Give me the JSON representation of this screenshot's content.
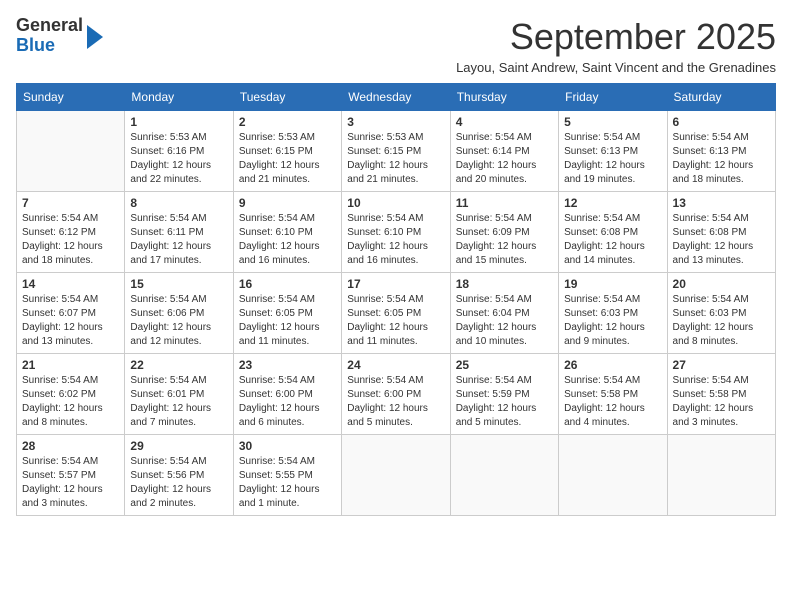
{
  "header": {
    "logo_line1": "General",
    "logo_line2": "Blue",
    "month": "September 2025",
    "subtitle": "Layou, Saint Andrew, Saint Vincent and the Grenadines"
  },
  "weekdays": [
    "Sunday",
    "Monday",
    "Tuesday",
    "Wednesday",
    "Thursday",
    "Friday",
    "Saturday"
  ],
  "weeks": [
    [
      {
        "day": "",
        "info": ""
      },
      {
        "day": "1",
        "info": "Sunrise: 5:53 AM\nSunset: 6:16 PM\nDaylight: 12 hours\nand 22 minutes."
      },
      {
        "day": "2",
        "info": "Sunrise: 5:53 AM\nSunset: 6:15 PM\nDaylight: 12 hours\nand 21 minutes."
      },
      {
        "day": "3",
        "info": "Sunrise: 5:53 AM\nSunset: 6:15 PM\nDaylight: 12 hours\nand 21 minutes."
      },
      {
        "day": "4",
        "info": "Sunrise: 5:54 AM\nSunset: 6:14 PM\nDaylight: 12 hours\nand 20 minutes."
      },
      {
        "day": "5",
        "info": "Sunrise: 5:54 AM\nSunset: 6:13 PM\nDaylight: 12 hours\nand 19 minutes."
      },
      {
        "day": "6",
        "info": "Sunrise: 5:54 AM\nSunset: 6:13 PM\nDaylight: 12 hours\nand 18 minutes."
      }
    ],
    [
      {
        "day": "7",
        "info": "Sunrise: 5:54 AM\nSunset: 6:12 PM\nDaylight: 12 hours\nand 18 minutes."
      },
      {
        "day": "8",
        "info": "Sunrise: 5:54 AM\nSunset: 6:11 PM\nDaylight: 12 hours\nand 17 minutes."
      },
      {
        "day": "9",
        "info": "Sunrise: 5:54 AM\nSunset: 6:10 PM\nDaylight: 12 hours\nand 16 minutes."
      },
      {
        "day": "10",
        "info": "Sunrise: 5:54 AM\nSunset: 6:10 PM\nDaylight: 12 hours\nand 16 minutes."
      },
      {
        "day": "11",
        "info": "Sunrise: 5:54 AM\nSunset: 6:09 PM\nDaylight: 12 hours\nand 15 minutes."
      },
      {
        "day": "12",
        "info": "Sunrise: 5:54 AM\nSunset: 6:08 PM\nDaylight: 12 hours\nand 14 minutes."
      },
      {
        "day": "13",
        "info": "Sunrise: 5:54 AM\nSunset: 6:08 PM\nDaylight: 12 hours\nand 13 minutes."
      }
    ],
    [
      {
        "day": "14",
        "info": "Sunrise: 5:54 AM\nSunset: 6:07 PM\nDaylight: 12 hours\nand 13 minutes."
      },
      {
        "day": "15",
        "info": "Sunrise: 5:54 AM\nSunset: 6:06 PM\nDaylight: 12 hours\nand 12 minutes."
      },
      {
        "day": "16",
        "info": "Sunrise: 5:54 AM\nSunset: 6:05 PM\nDaylight: 12 hours\nand 11 minutes."
      },
      {
        "day": "17",
        "info": "Sunrise: 5:54 AM\nSunset: 6:05 PM\nDaylight: 12 hours\nand 11 minutes."
      },
      {
        "day": "18",
        "info": "Sunrise: 5:54 AM\nSunset: 6:04 PM\nDaylight: 12 hours\nand 10 minutes."
      },
      {
        "day": "19",
        "info": "Sunrise: 5:54 AM\nSunset: 6:03 PM\nDaylight: 12 hours\nand 9 minutes."
      },
      {
        "day": "20",
        "info": "Sunrise: 5:54 AM\nSunset: 6:03 PM\nDaylight: 12 hours\nand 8 minutes."
      }
    ],
    [
      {
        "day": "21",
        "info": "Sunrise: 5:54 AM\nSunset: 6:02 PM\nDaylight: 12 hours\nand 8 minutes."
      },
      {
        "day": "22",
        "info": "Sunrise: 5:54 AM\nSunset: 6:01 PM\nDaylight: 12 hours\nand 7 minutes."
      },
      {
        "day": "23",
        "info": "Sunrise: 5:54 AM\nSunset: 6:00 PM\nDaylight: 12 hours\nand 6 minutes."
      },
      {
        "day": "24",
        "info": "Sunrise: 5:54 AM\nSunset: 6:00 PM\nDaylight: 12 hours\nand 5 minutes."
      },
      {
        "day": "25",
        "info": "Sunrise: 5:54 AM\nSunset: 5:59 PM\nDaylight: 12 hours\nand 5 minutes."
      },
      {
        "day": "26",
        "info": "Sunrise: 5:54 AM\nSunset: 5:58 PM\nDaylight: 12 hours\nand 4 minutes."
      },
      {
        "day": "27",
        "info": "Sunrise: 5:54 AM\nSunset: 5:58 PM\nDaylight: 12 hours\nand 3 minutes."
      }
    ],
    [
      {
        "day": "28",
        "info": "Sunrise: 5:54 AM\nSunset: 5:57 PM\nDaylight: 12 hours\nand 3 minutes."
      },
      {
        "day": "29",
        "info": "Sunrise: 5:54 AM\nSunset: 5:56 PM\nDaylight: 12 hours\nand 2 minutes."
      },
      {
        "day": "30",
        "info": "Sunrise: 5:54 AM\nSunset: 5:55 PM\nDaylight: 12 hours\nand 1 minute."
      },
      {
        "day": "",
        "info": ""
      },
      {
        "day": "",
        "info": ""
      },
      {
        "day": "",
        "info": ""
      },
      {
        "day": "",
        "info": ""
      }
    ]
  ]
}
